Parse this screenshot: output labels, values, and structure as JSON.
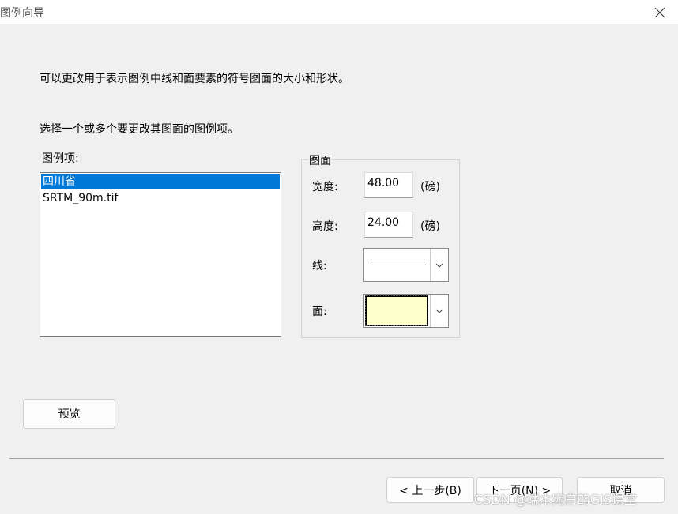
{
  "window": {
    "title": "图例向导",
    "close_icon": "×"
  },
  "instructions": {
    "line1": "可以更改用于表示图例中线和面要素的符号图面的大小和形状。",
    "line2": "选择一个或多个要更改其图面的图例项。"
  },
  "legend_items": {
    "label": "图例项:",
    "items": [
      {
        "label": "四川省",
        "selected": true
      },
      {
        "label": "SRTM_90m.tif",
        "selected": false
      }
    ]
  },
  "patch": {
    "group_title": "图面",
    "width_label": "宽度:",
    "width_value": "48.00",
    "width_unit": "(磅)",
    "height_label": "高度:",
    "height_value": "24.00",
    "height_unit": "(磅)",
    "line_label": "线:",
    "area_label": "面:",
    "area_fill_color": "#ffffcc"
  },
  "buttons": {
    "preview": "预览",
    "back": "< 上一步(B)",
    "next": "下一页(N) >",
    "cancel": "取消"
  },
  "watermark": "CSDN @端木宛白的GIS课堂"
}
